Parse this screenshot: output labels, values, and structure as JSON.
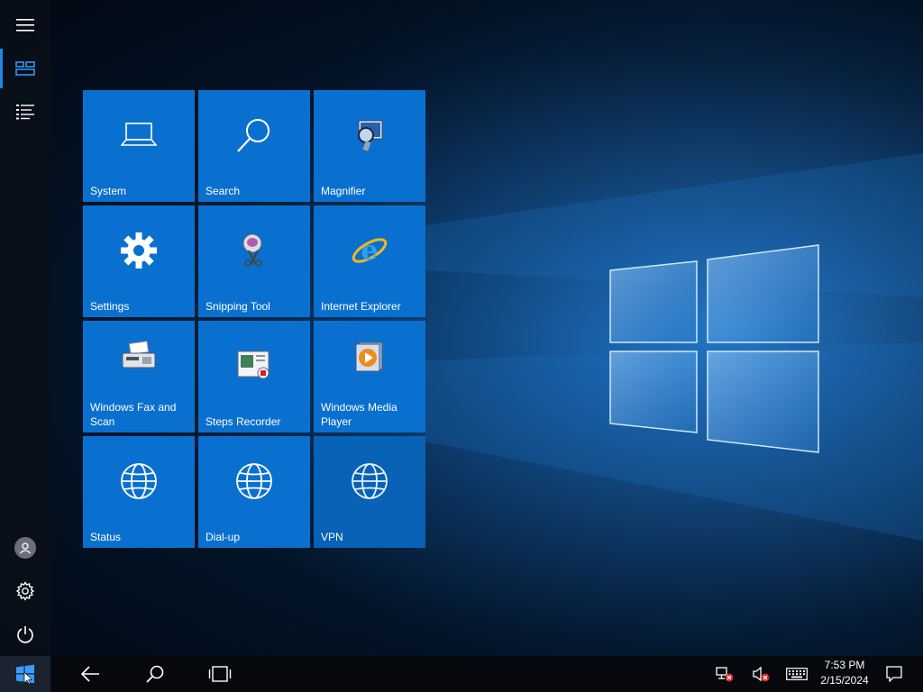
{
  "start_menu": {
    "rail": {
      "top_items": [
        {
          "icon": "hamburger-icon"
        },
        {
          "icon": "tiles-icon"
        },
        {
          "icon": "all-apps-list-icon"
        }
      ],
      "bottom_items": [
        {
          "icon": "user-account-icon"
        },
        {
          "icon": "settings-gear-icon"
        },
        {
          "icon": "power-icon"
        }
      ]
    },
    "tiles": [
      {
        "label": "System",
        "icon": "laptop-icon"
      },
      {
        "label": "Search",
        "icon": "search-icon"
      },
      {
        "label": "Magnifier",
        "icon": "magnifier-app-icon"
      },
      {
        "label": "Settings",
        "icon": "settings-gear-icon"
      },
      {
        "label": "Snipping Tool",
        "icon": "snipping-tool-icon"
      },
      {
        "label": "Internet Explorer",
        "icon": "internet-explorer-icon"
      },
      {
        "label": "Windows Fax and Scan",
        "icon": "fax-scanner-icon"
      },
      {
        "label": "Steps Recorder",
        "icon": "steps-recorder-icon"
      },
      {
        "label": "Windows Media Player",
        "icon": "media-player-icon"
      },
      {
        "label": "Status",
        "icon": "globe-icon"
      },
      {
        "label": "Dial-up",
        "icon": "globe-icon"
      },
      {
        "label": "VPN",
        "icon": "globe-icon"
      }
    ]
  },
  "taskbar": {
    "buttons": [
      {
        "icon": "windows-logo-icon"
      },
      {
        "icon": "back-arrow-icon"
      },
      {
        "icon": "search-icon"
      },
      {
        "icon": "task-view-icon"
      }
    ],
    "tray": [
      {
        "icon": "network-disconnected-icon"
      },
      {
        "icon": "volume-muted-icon"
      },
      {
        "icon": "touch-keyboard-icon"
      }
    ],
    "clock": {
      "time": "7:53 PM",
      "date": "2/15/2024"
    },
    "notification": {
      "icon": "action-center-icon"
    }
  },
  "colors": {
    "tile": "#0a70cf",
    "tile_dim": "#0862b6",
    "accent": "#1f86e6",
    "taskbar": "#06080d"
  }
}
